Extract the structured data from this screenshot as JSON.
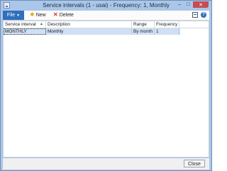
{
  "window": {
    "title": "Service intervals (1 - usai) - Frequency: 1, Monthly",
    "minimize_glyph": "–",
    "maximize_glyph": "□",
    "close_glyph": "✕"
  },
  "toolbar": {
    "file_label": "File",
    "new_label": "New",
    "delete_label": "Delete",
    "icons": [
      "new-star-icon",
      "delete-x-icon",
      "grid-view-icon",
      "help-icon"
    ]
  },
  "grid": {
    "columns": [
      "Service interval",
      "Description",
      "Range",
      "Frequency"
    ],
    "rows": [
      {
        "service_interval": "MONTHLY",
        "description": "Monthly",
        "range": "By month",
        "frequency": "1"
      }
    ]
  },
  "footer": {
    "close_label": "Close"
  },
  "colors": {
    "accent": "#2f6fbc",
    "selected_row": "#cfe0f4",
    "frame": "#aac6e8"
  }
}
